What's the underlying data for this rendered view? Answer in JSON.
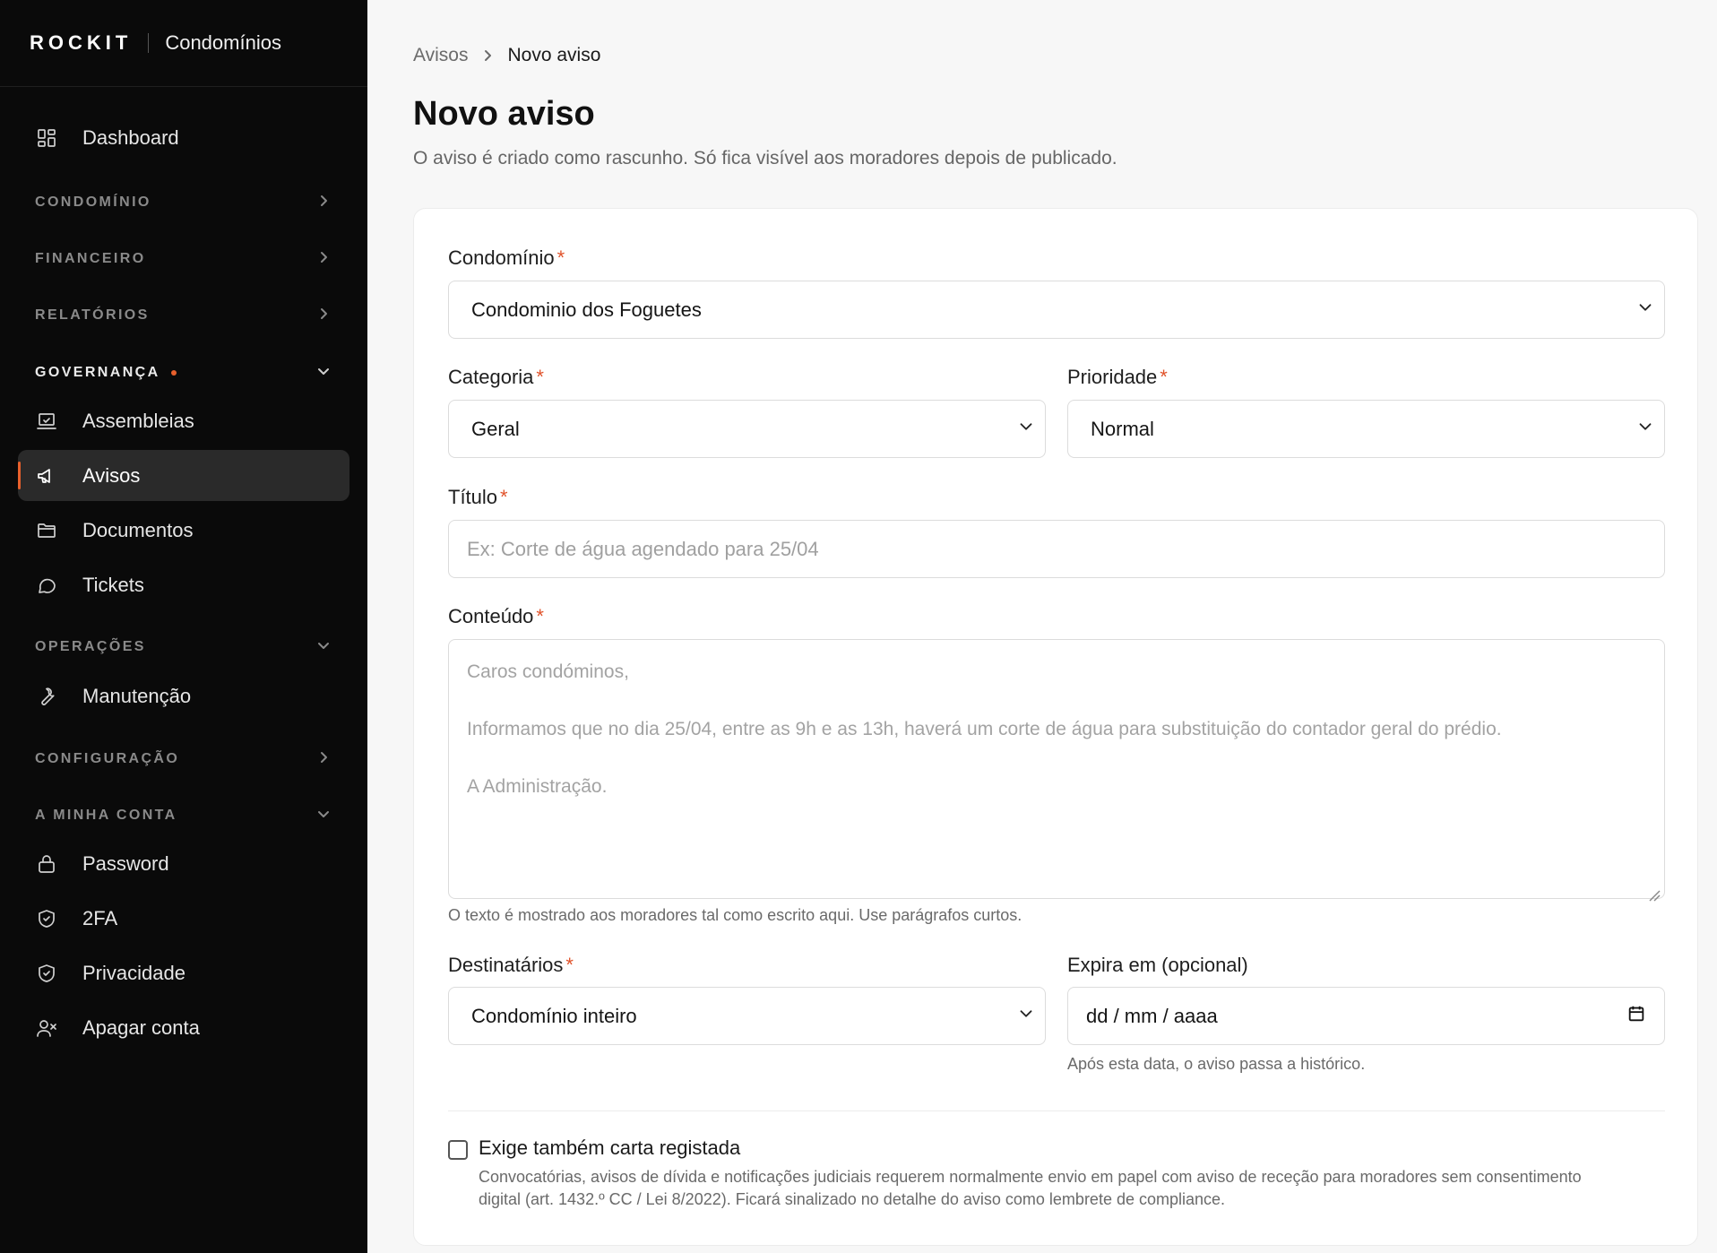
{
  "brand": {
    "logo": "ROCKIT",
    "app": "Condomínios"
  },
  "sidebar": {
    "dashboard": "Dashboard",
    "sections": {
      "condominio": "CONDOMÍNIO",
      "financeiro": "FINANCEIRO",
      "relatorios": "RELATÓRIOS",
      "governanca": "GOVERNANÇA",
      "operacoes": "OPERAÇÕES",
      "configuracao": "CONFIGURAÇÃO",
      "minha_conta": "A MINHA CONTA"
    },
    "governanca_items": [
      "Assembleias",
      "Avisos",
      "Documentos",
      "Tickets"
    ],
    "operacoes_items": [
      "Manutenção"
    ],
    "conta_items": [
      "Password",
      "2FA",
      "Privacidade",
      "Apagar conta"
    ],
    "active_item": "Avisos",
    "accent_color": "#e8602c"
  },
  "breadcrumb": {
    "parent": "Avisos",
    "current": "Novo aviso"
  },
  "page": {
    "title": "Novo aviso",
    "subtitle": "O aviso é criado como rascunho. Só fica visível aos moradores depois de publicado."
  },
  "form": {
    "required_mark": "*",
    "condominio": {
      "label": "Condomínio",
      "value": "Condominio dos Foguetes"
    },
    "categoria": {
      "label": "Categoria",
      "value": "Geral"
    },
    "prioridade": {
      "label": "Prioridade",
      "value": "Normal"
    },
    "titulo": {
      "label": "Título",
      "placeholder": "Ex: Corte de água agendado para 25/04"
    },
    "conteudo": {
      "label": "Conteúdo",
      "placeholder_lines": [
        "Caros condóminos,",
        "Informamos que no dia 25/04, entre as 9h e as 13h, haverá um corte de água para substituição do contador geral do prédio.",
        "A Administração."
      ],
      "help": "O texto é mostrado aos moradores tal como escrito aqui. Use parágrafos curtos."
    },
    "destinatarios": {
      "label": "Destinatários",
      "value": "Condomínio inteiro"
    },
    "expira": {
      "label": "Expira em (opcional)",
      "value": "dd / mm / aaaa",
      "help": "Após esta data, o aviso passa a histórico."
    },
    "carta": {
      "label": "Exige também carta registada",
      "checked": false,
      "description": "Convocatórias, avisos de dívida e notificações judiciais requerem normalmente envio em papel com aviso de receção para moradores sem consentimento digital (art. 1432.º CC / Lei 8/2022). Ficará sinalizado no detalhe do aviso como lembrete de compliance."
    }
  }
}
